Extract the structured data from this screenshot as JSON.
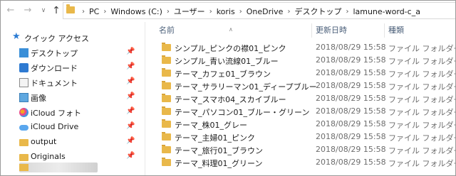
{
  "address": {
    "crumbs": [
      "PC",
      "Windows (C:)",
      "ユーザー",
      "koris",
      "OneDrive",
      "デスクトップ",
      "lamune-word-c_a"
    ]
  },
  "nav": {
    "back_icon": "arrow-left-icon",
    "forward_icon": "arrow-right-icon",
    "recent_icon": "chevron-down-icon",
    "up_icon": "arrow-up-icon"
  },
  "sidebar": {
    "quick_access": "クイック アクセス",
    "items": [
      {
        "label": "デスクトップ",
        "icon": "desktop-icon",
        "pinned": true
      },
      {
        "label": "ダウンロード",
        "icon": "download-icon",
        "pinned": true
      },
      {
        "label": "ドキュメント",
        "icon": "document-icon",
        "pinned": true
      },
      {
        "label": "画像",
        "icon": "pictures-icon",
        "pinned": true
      },
      {
        "label": "iCloud フォト",
        "icon": "icloud-photos-icon",
        "pinned": true
      },
      {
        "label": "iCloud Drive",
        "icon": "icloud-drive-icon",
        "pinned": true
      },
      {
        "label": "output",
        "icon": "folder-icon",
        "pinned": true
      },
      {
        "label": "Originals",
        "icon": "folder-icon",
        "pinned": true
      }
    ]
  },
  "columns": {
    "name": "名前",
    "date": "更新日時",
    "type": "種類"
  },
  "files": [
    {
      "name": "シンプル_ピンクの襟01_ピンク",
      "date": "2018/08/29 15:58",
      "type": "ファイル フォルダー"
    },
    {
      "name": "シンプル_青い流線01_ブルー",
      "date": "2018/08/29 15:58",
      "type": "ファイル フォルダー"
    },
    {
      "name": "テーマ_カフェ01_ブラウン",
      "date": "2018/08/29 15:58",
      "type": "ファイル フォルダー"
    },
    {
      "name": "テーマ_サラリーマン01_ディープブルー",
      "date": "2018/08/29 15:58",
      "type": "ファイル フォルダー"
    },
    {
      "name": "テーマ_スマホ04_スカイブルー",
      "date": "2018/08/29 15:58",
      "type": "ファイル フォルダー"
    },
    {
      "name": "テーマ_パソコン01_ブルー・グリーン",
      "date": "2018/08/29 15:58",
      "type": "ファイル フォルダー"
    },
    {
      "name": "テーマ_株01_グレー",
      "date": "2018/08/29 15:58",
      "type": "ファイル フォルダー"
    },
    {
      "name": "テーマ_主婦01_ピンク",
      "date": "2018/08/29 15:58",
      "type": "ファイル フォルダー"
    },
    {
      "name": "テーマ_旅行01_ブラウン",
      "date": "2018/08/29 15:58",
      "type": "ファイル フォルダー"
    },
    {
      "name": "テーマ_料理01_グリーン",
      "date": "2018/08/29 15:58",
      "type": "ファイル フォルダー"
    }
  ],
  "colors": {
    "folder": "#e9b84a",
    "accent": "#2b7bd3",
    "header_text": "#4c607a"
  }
}
